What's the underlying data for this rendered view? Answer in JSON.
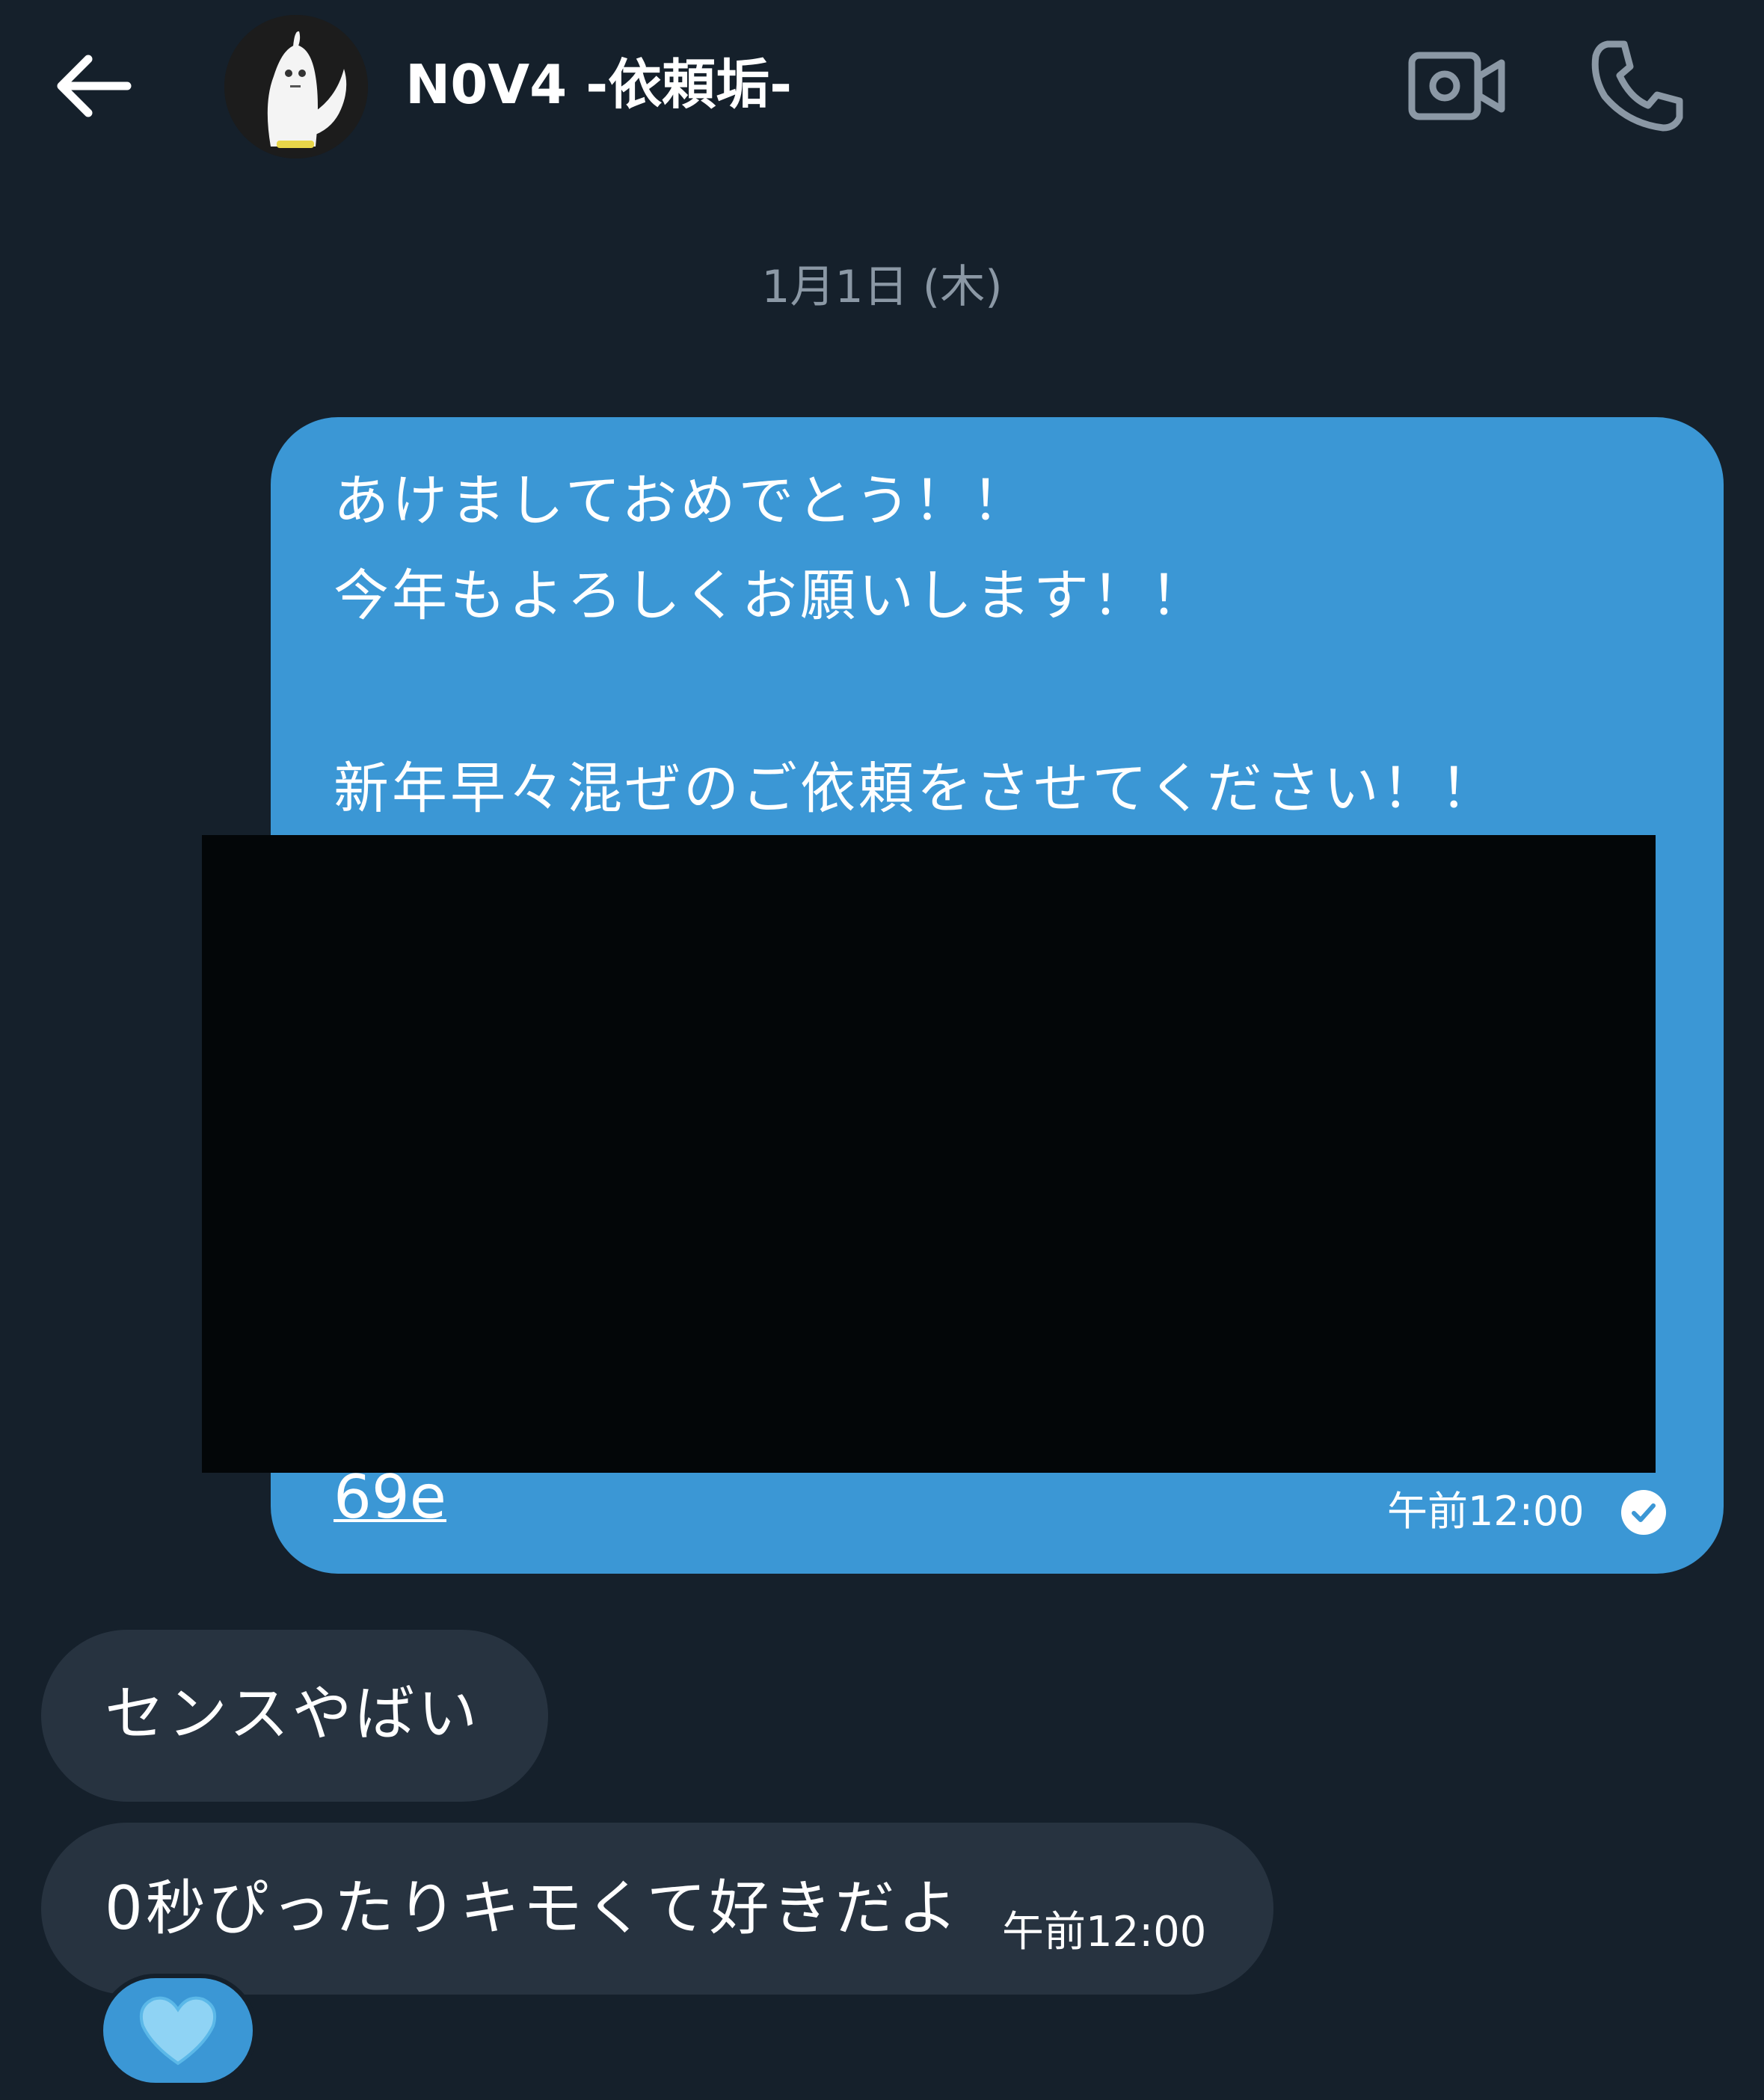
{
  "header": {
    "title": "N0V4 -依頼垢-",
    "back_icon": "arrow-left-icon",
    "video_icon": "video-call-icon",
    "phone_icon": "phone-icon"
  },
  "date_separator": "1月1日 (木)",
  "outgoing_message": {
    "lines": [
      "あけましておめでとう！！",
      "今年もよろしくお願いします！！",
      "新年早々混ぜのご依頼をさせてください！！"
    ],
    "link_text": "69e",
    "time": "午前12:00",
    "status_icon": "read-check-icon"
  },
  "incoming_messages": [
    {
      "text": "センスやばい"
    },
    {
      "text": "0秒ぴったりキモくて好きだよ",
      "time": "午前12:00"
    }
  ],
  "reaction": {
    "emoji": "💙",
    "icon": "blue-heart-icon"
  },
  "colors": {
    "background": "#15202b",
    "outgoing_bubble": "#3b97d5",
    "incoming_bubble": "#273340",
    "muted_text": "#8b98a5",
    "redaction": "#030608"
  }
}
